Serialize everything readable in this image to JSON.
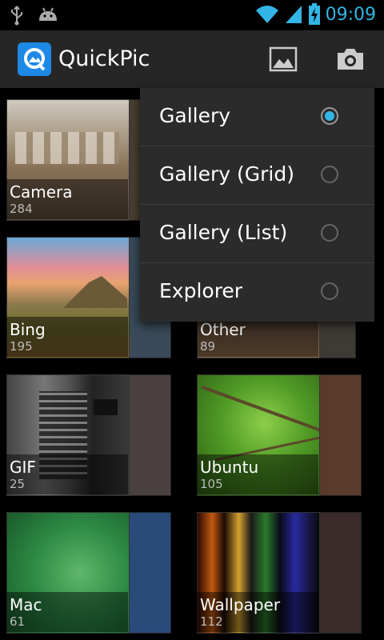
{
  "status_bar": {
    "time": "09:09",
    "icons": [
      "usb-icon",
      "android-debug-icon",
      "wifi-icon",
      "signal-icon",
      "battery-charging-icon"
    ]
  },
  "action_bar": {
    "app_name": "QuickPic",
    "icons": [
      "quickpic-logo-icon",
      "image-view-icon",
      "camera-icon"
    ]
  },
  "albums": [
    {
      "name": "Camera",
      "count": "284"
    },
    {
      "name": "Bing",
      "count": "195"
    },
    {
      "name": "Other",
      "count": "89"
    },
    {
      "name": "GIF",
      "count": "25"
    },
    {
      "name": "Ubuntu",
      "count": "105"
    },
    {
      "name": "Mac",
      "count": "61"
    },
    {
      "name": "Wallpaper",
      "count": "112"
    }
  ],
  "view_menu": {
    "items": [
      {
        "label": "Gallery",
        "selected": true
      },
      {
        "label": "Gallery (Grid)",
        "selected": false
      },
      {
        "label": "Gallery (List)",
        "selected": false
      },
      {
        "label": "Explorer",
        "selected": false
      }
    ]
  },
  "colors": {
    "accent": "#33b5e5",
    "action_bar_bg": "#262626",
    "menu_bg": "#2b2b2b"
  }
}
